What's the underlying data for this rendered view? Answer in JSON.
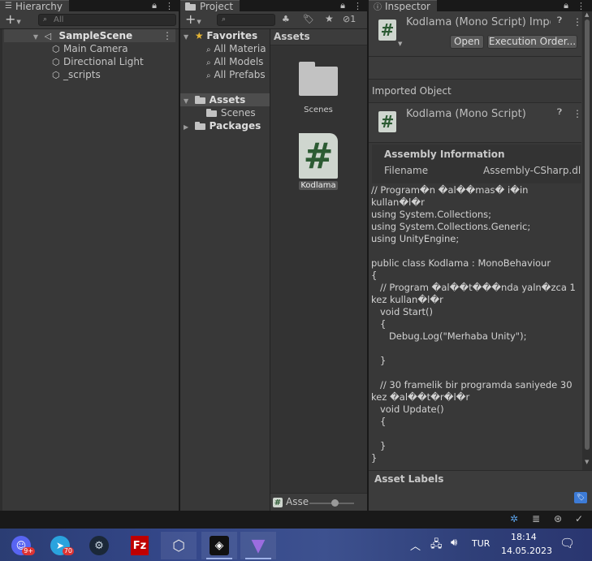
{
  "hierarchy": {
    "tab_title": "Hierarchy",
    "search_placeholder": "All",
    "scene_name": "SampleScene",
    "items": [
      "Main Camera",
      "Directional Light",
      "_scripts"
    ]
  },
  "project": {
    "tab_title": "Project",
    "hidden_count": "1",
    "favorites_label": "Favorites",
    "favorites": [
      "All Materia",
      "All Models",
      "All Prefabs"
    ],
    "assets_label": "Assets",
    "scenes_label": "Scenes",
    "packages_label": "Packages",
    "breadcrumb": "Assets",
    "grid_items": [
      "Scenes",
      "Kodlama"
    ],
    "footer_path": "Asse"
  },
  "inspector": {
    "tab_title": "Inspector",
    "header_title": "Kodlama (Mono Script) Impor",
    "open_label": "Open",
    "exec_order_label": "Execution Order...",
    "imported_object_label": "Imported Object",
    "imported_title": "Kodlama (Mono Script)",
    "assembly_info_label": "Assembly Information",
    "filename_label": "Filename",
    "filename_value": "Assembly-CSharp.dl",
    "code_text": "// Program�n �al��mas� i�in kullan�l�r\nusing System.Collections;\nusing System.Collections.Generic;\nusing UnityEngine;\n\npublic class Kodlama : MonoBehaviour\n{\n   // Program �al��t���nda yaln�zca 1 kez kullan�l�r\n   void Start()\n   {\n      Debug.Log(\"Merhaba Unity\");\n\n   }\n\n   // 30 framelik bir programda saniyede 30 kez �al��t�r�l�r\n   void Update()\n   {\n\n   }\n}",
    "asset_labels_label": "Asset Labels"
  },
  "taskbar": {
    "apps": [
      {
        "name": "discord",
        "badge": "9+"
      },
      {
        "name": "telegram",
        "badge": "70"
      },
      {
        "name": "steam",
        "badge": ""
      },
      {
        "name": "filezilla",
        "badge": ""
      },
      {
        "name": "unity-hub",
        "badge": ""
      },
      {
        "name": "unity-editor",
        "badge": ""
      },
      {
        "name": "visual-studio",
        "badge": ""
      }
    ],
    "language": "TUR",
    "time": "18:14",
    "date": "14.05.2023"
  },
  "colors": {
    "selection": "#2c5d87",
    "panel_bg": "#383838",
    "script_icon_bg": "#cfd6cf",
    "script_icon_fg": "#2c5b33"
  }
}
